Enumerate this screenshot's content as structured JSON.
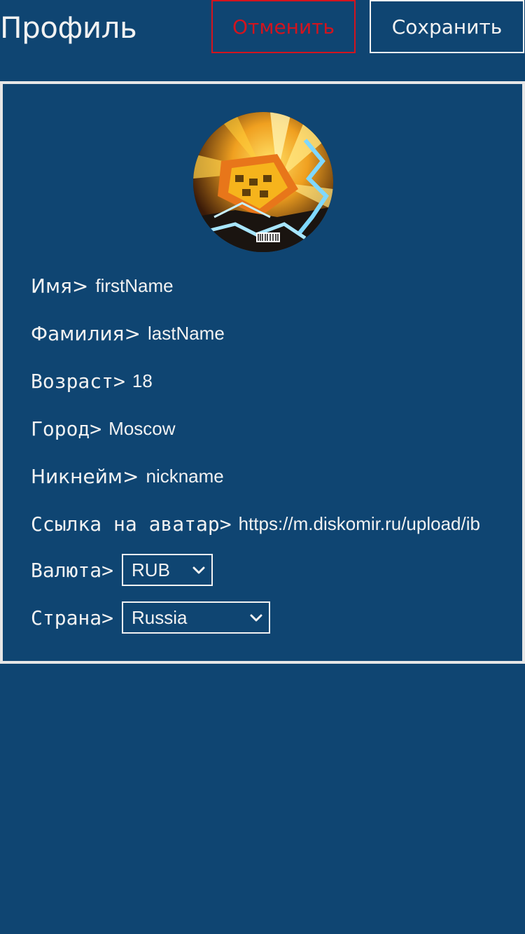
{
  "header": {
    "title": "Профиль",
    "cancel_label": "Отменить",
    "save_label": "Сохранить"
  },
  "colors": {
    "background": "#0f4572",
    "cancel_accent": "#d2141e",
    "text": "#f2f2f2",
    "card_border": "#e6e6e6"
  },
  "profile": {
    "avatar_icon": "avatar-image",
    "fields": [
      {
        "label": "Имя>",
        "value": "firstName"
      },
      {
        "label": "Фамилия>",
        "value": "lastName"
      },
      {
        "label": "Возраст>",
        "value": "18"
      },
      {
        "label": "Город>",
        "value": "Moscow"
      },
      {
        "label": "Никнейм>",
        "value": "nickname"
      },
      {
        "label": "Ссылка на аватар>",
        "value": "https://m.diskomir.ru/upload/ib"
      }
    ],
    "currency": {
      "label": "Валюта>",
      "selected": "RUB",
      "icon": "chevron-down-icon"
    },
    "country": {
      "label": "Страна>",
      "selected": "Russia",
      "icon": "chevron-down-icon"
    }
  }
}
